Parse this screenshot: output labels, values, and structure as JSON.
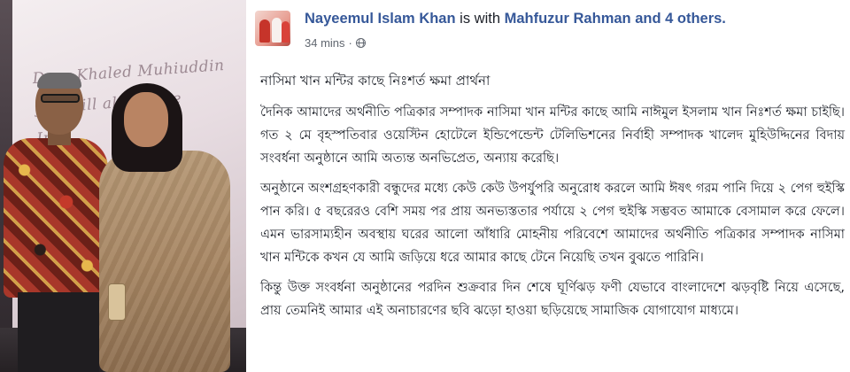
{
  "post": {
    "author": "Nayeemul Islam Khan",
    "with_text": "is with",
    "tagged": "Mahfuzur Rahman and 4 others.",
    "time": "34 mins",
    "separator": "·",
    "privacy_icon": "globe-icon",
    "title": "নাসিমা খান মন্টির কাছে নিঃশর্ত ক্ষমা প্রার্থনা",
    "paragraphs": [
      "দৈনিক আমাদের অর্থনীতি পত্রিকার সম্পাদক নাসিমা খান মন্টির কাছে আমি নাঈমুল ইসলাম খান নিঃশর্ত ক্ষমা চাইছি। গত ২ মে বৃহস্পতিবার ওয়েস্টিন হোটেলে ইন্ডিপেন্ডেন্ট টেলিভিশনের নির্বাহী সম্পাদক খালেদ মুহিউদ্দিনের বিদায় সংবর্ধনা অনুষ্ঠানে আমি অত্যন্ত অনভিপ্রেত, অন্যায় করেছি।",
      "অনুষ্ঠানে অংশগ্রহণকারী বন্ধুদের মধ্যে কেউ কেউ উপর্যুপরি অনুরোধ করলে আমি ঈষৎ গরম পানি দিয়ে ২ পেগ হুইস্কি পান করি। ৫ বছরেরও বেশি সময় পর প্রায় অনভ্যস্ততার পর্যায়ে ২ পেগ হুইস্কি সম্ভবত আমাকে বেসামাল করে ফেলে। এমন ভারসাম্যহীন অবস্থায় ঘরের আলো আঁধারি মোহনীয় পরিবেশে আমাদের অর্থনীতি পত্রিকার সম্পাদক নাসিমা খান মন্টিকে কখন যে আমি জড়িয়ে ধরে আমার কাছে টেনে নিয়েছি তখন বুঝতে পারিনি।",
      "কিন্তু উক্ত সংবর্ধনা অনুষ্ঠানের পরদিন শুক্রবার দিন শেষে ঘূর্ণিঝড় ফণী যেভাবে বাংলাদেশে ঝড়বৃষ্টি নিয়ে এসেছে, প্রায় তেমনিই আমার এই অনাচারণের ছবি ঝড়ো হাওয়া ছড়িয়েছে সামাজিক যোগাযোগ মাধ্যমে।"
    ]
  },
  "photo": {
    "backdrop_text": [
      "Dear Khaled Muhiuddin",
      "you will always be",
      "Imp",
      "ily"
    ],
    "avatar_icon": "profile-photo"
  },
  "colors": {
    "link": "#365899",
    "text": "#1d2129",
    "meta": "#616770"
  }
}
